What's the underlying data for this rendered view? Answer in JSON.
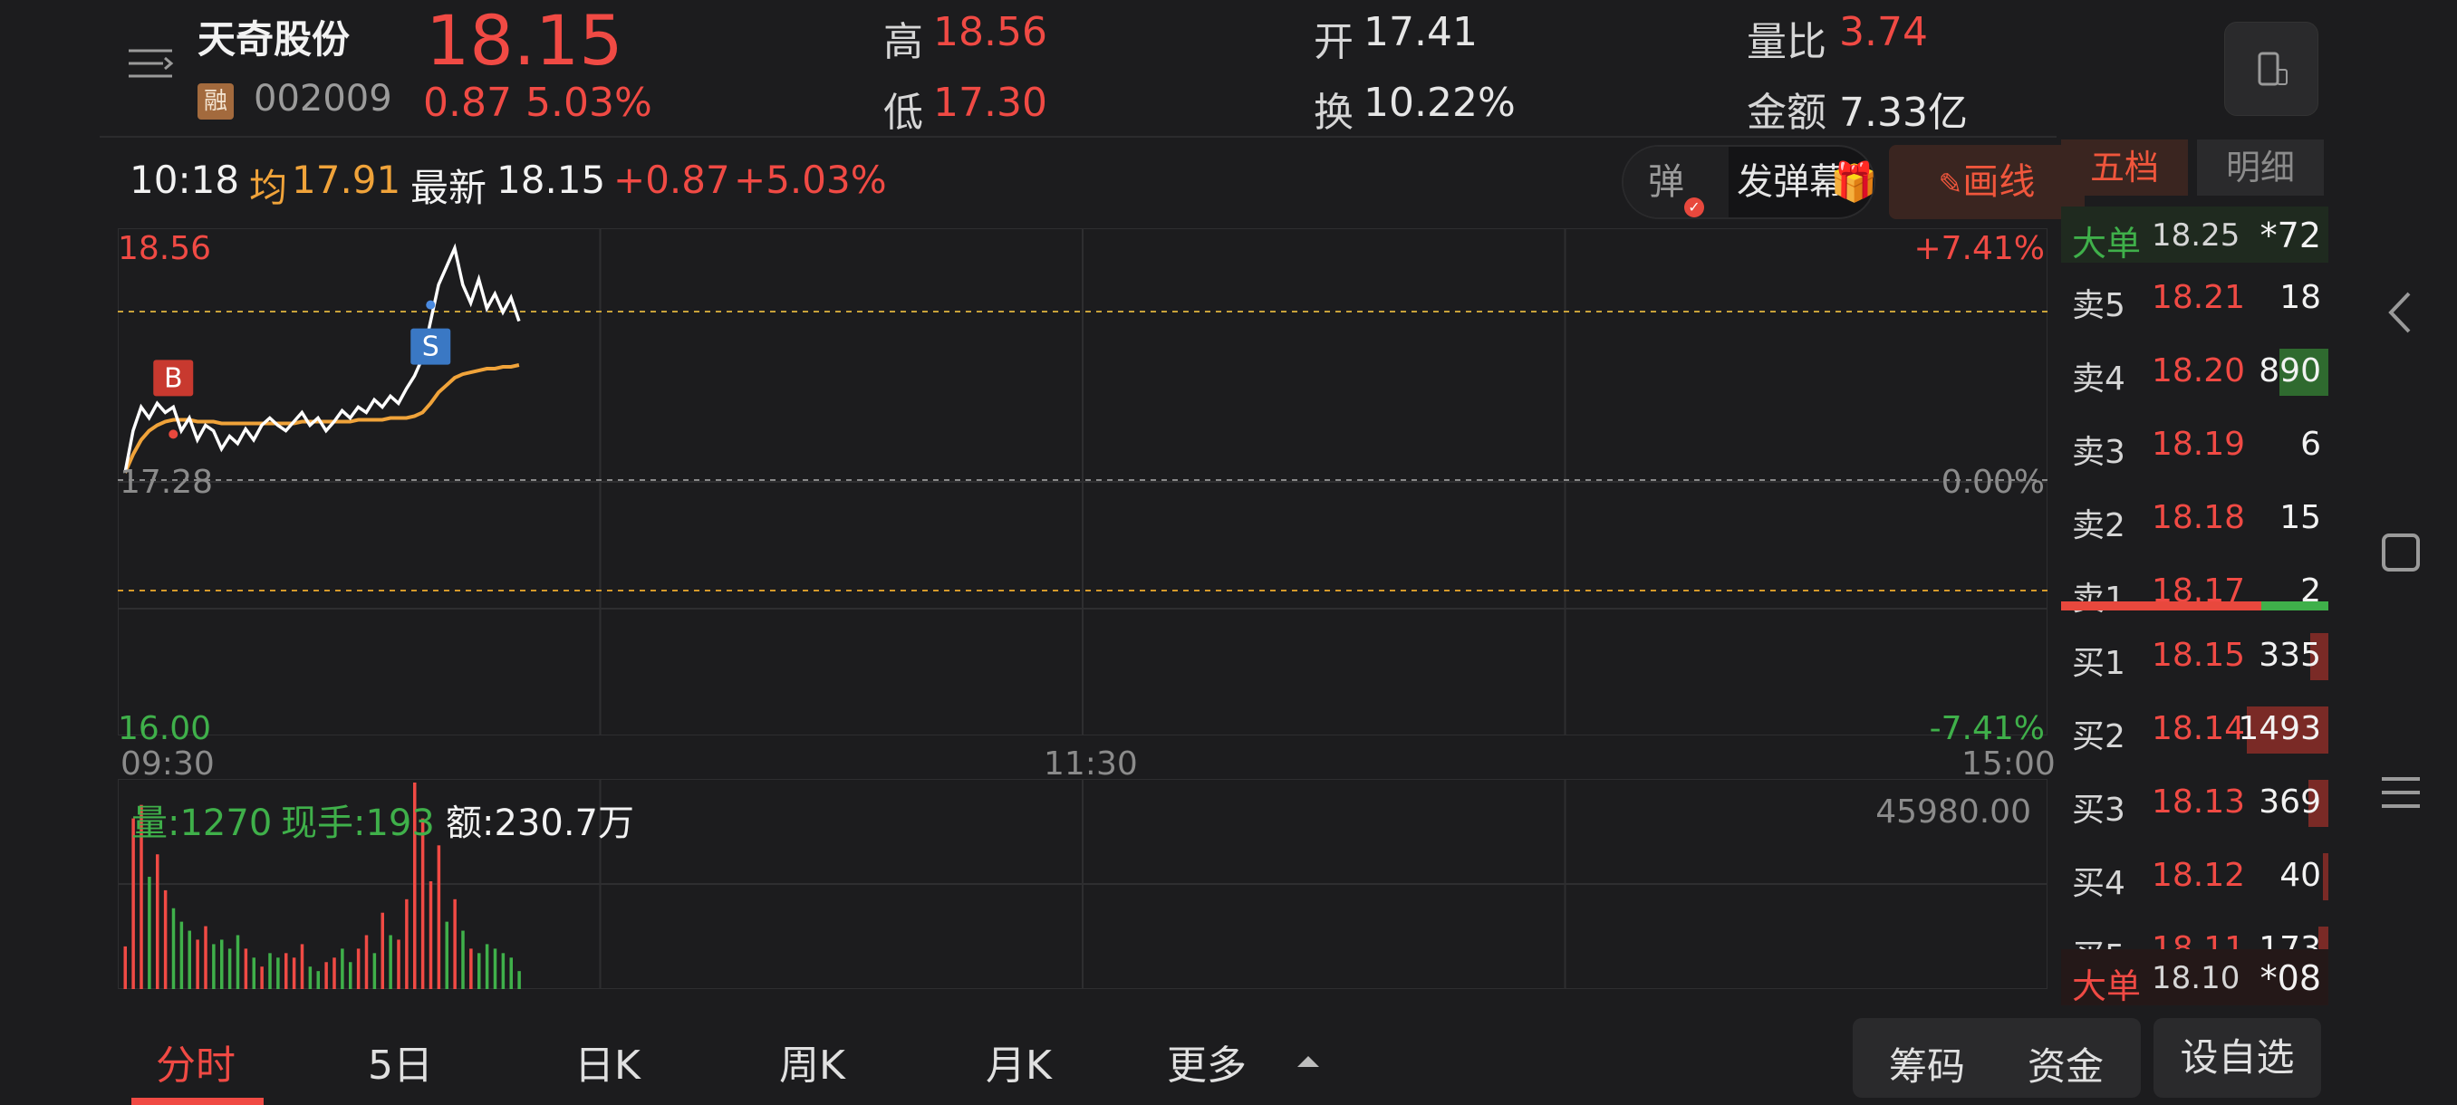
{
  "stock": {
    "name": "天奇股份",
    "badge": "融",
    "code": "002009",
    "price": "18.15",
    "change_abs": "0.87",
    "change_pct": "5.03%"
  },
  "stats": {
    "high_label": "高",
    "high": "18.56",
    "low_label": "低",
    "low": "17.30",
    "open_label": "开",
    "open": "17.41",
    "turnover_label": "换",
    "turnover": "10.22%",
    "vol_ratio_label": "量比",
    "vol_ratio": "3.74",
    "amount_label": "金额",
    "amount": "7.33亿"
  },
  "info": {
    "time": "10:18",
    "avg_label": "均",
    "avg": "17.91",
    "latest_label": "最新",
    "latest": "18.15",
    "change": "+0.87",
    "change_pct": "+5.03%"
  },
  "controls": {
    "danmu_toggle": "弹",
    "send_danmu": "发弹幕",
    "draw_line": "画线"
  },
  "chart_labels": {
    "y_top": "18.56",
    "y_mid": "17.28",
    "y_bottom": "16.00",
    "pct_top": "+7.41%",
    "pct_mid": "0.00%",
    "pct_bottom": "-7.41%",
    "x_start": "09:30",
    "x_mid": "11:30",
    "x_end": "15:00",
    "buy_marker": "B",
    "sell_marker": "S"
  },
  "volume": {
    "vol_label": "量:1270",
    "current_label": "现手:193",
    "amount_label": "额:230.7万",
    "max": "45980.00"
  },
  "chart_data": {
    "type": "line",
    "x_range": [
      "09:30",
      "15:00"
    ],
    "ylim": [
      16.0,
      18.56
    ],
    "series": [
      {
        "name": "最新",
        "values": [
          17.32,
          17.55,
          17.68,
          17.62,
          17.7,
          17.65,
          17.68,
          17.55,
          17.62,
          17.5,
          17.58,
          17.55,
          17.45,
          17.52,
          17.48,
          17.56,
          17.5,
          17.58,
          17.62,
          17.58,
          17.55,
          17.6,
          17.65,
          17.58,
          17.62,
          17.55,
          17.6,
          17.66,
          17.62,
          17.68,
          17.65,
          17.72,
          17.68,
          17.74,
          17.7,
          17.78,
          17.85,
          17.95,
          18.15,
          18.35,
          18.45,
          18.55,
          18.35,
          18.25,
          18.38,
          18.22,
          18.3,
          18.2,
          18.28,
          18.15
        ]
      },
      {
        "name": "均",
        "values": [
          17.32,
          17.42,
          17.5,
          17.55,
          17.58,
          17.6,
          17.61,
          17.61,
          17.61,
          17.6,
          17.6,
          17.6,
          17.59,
          17.59,
          17.59,
          17.59,
          17.59,
          17.59,
          17.59,
          17.59,
          17.59,
          17.59,
          17.6,
          17.6,
          17.6,
          17.6,
          17.6,
          17.6,
          17.6,
          17.61,
          17.61,
          17.61,
          17.61,
          17.62,
          17.62,
          17.62,
          17.63,
          17.65,
          17.7,
          17.76,
          17.8,
          17.84,
          17.86,
          17.87,
          17.88,
          17.89,
          17.89,
          17.9,
          17.9,
          17.91
        ]
      }
    ],
    "volumes": [
      {
        "v": 9500,
        "c": "r"
      },
      {
        "v": 38000,
        "c": "r"
      },
      {
        "v": 41000,
        "c": "r"
      },
      {
        "v": 25000,
        "c": "g"
      },
      {
        "v": 30000,
        "c": "r"
      },
      {
        "v": 22000,
        "c": "r"
      },
      {
        "v": 18000,
        "c": "g"
      },
      {
        "v": 15000,
        "c": "g"
      },
      {
        "v": 13000,
        "c": "g"
      },
      {
        "v": 11000,
        "c": "r"
      },
      {
        "v": 14000,
        "c": "r"
      },
      {
        "v": 10000,
        "c": "g"
      },
      {
        "v": 11000,
        "c": "g"
      },
      {
        "v": 9000,
        "c": "g"
      },
      {
        "v": 12000,
        "c": "g"
      },
      {
        "v": 9000,
        "c": "r"
      },
      {
        "v": 7000,
        "c": "g"
      },
      {
        "v": 5000,
        "c": "r"
      },
      {
        "v": 8000,
        "c": "g"
      },
      {
        "v": 7000,
        "c": "g"
      },
      {
        "v": 8000,
        "c": "r"
      },
      {
        "v": 7000,
        "c": "r"
      },
      {
        "v": 10000,
        "c": "r"
      },
      {
        "v": 5000,
        "c": "g"
      },
      {
        "v": 4000,
        "c": "g"
      },
      {
        "v": 6000,
        "c": "r"
      },
      {
        "v": 7000,
        "c": "r"
      },
      {
        "v": 9000,
        "c": "g"
      },
      {
        "v": 6000,
        "c": "g"
      },
      {
        "v": 9000,
        "c": "r"
      },
      {
        "v": 12000,
        "c": "r"
      },
      {
        "v": 8000,
        "c": "g"
      },
      {
        "v": 17000,
        "c": "r"
      },
      {
        "v": 12000,
        "c": "g"
      },
      {
        "v": 11000,
        "c": "r"
      },
      {
        "v": 20000,
        "c": "r"
      },
      {
        "v": 45980,
        "c": "r"
      },
      {
        "v": 38000,
        "c": "r"
      },
      {
        "v": 24000,
        "c": "r"
      },
      {
        "v": 32000,
        "c": "r"
      },
      {
        "v": 15000,
        "c": "g"
      },
      {
        "v": 20000,
        "c": "r"
      },
      {
        "v": 13000,
        "c": "g"
      },
      {
        "v": 9000,
        "c": "r"
      },
      {
        "v": 8000,
        "c": "g"
      },
      {
        "v": 10000,
        "c": "g"
      },
      {
        "v": 9000,
        "c": "g"
      },
      {
        "v": 8000,
        "c": "g"
      },
      {
        "v": 7000,
        "c": "g"
      },
      {
        "v": 4000,
        "c": "g"
      }
    ]
  },
  "orderbook": {
    "tab_active": "五档",
    "tab_other": "明细",
    "big_top": {
      "label": "大单",
      "price": "18.25",
      "qty": "*72"
    },
    "asks": [
      {
        "label": "卖5",
        "price": "18.21",
        "qty": "18",
        "fill": 0.0
      },
      {
        "label": "卖4",
        "price": "18.20",
        "qty": "890",
        "fill": 0.6
      },
      {
        "label": "卖3",
        "price": "18.19",
        "qty": "6",
        "fill": 0.0
      },
      {
        "label": "卖2",
        "price": "18.18",
        "qty": "15",
        "fill": 0.0
      },
      {
        "label": "卖1",
        "price": "18.17",
        "qty": "2",
        "fill": 0.0
      }
    ],
    "bids": [
      {
        "label": "买1",
        "price": "18.15",
        "qty": "335",
        "fill": 0.22
      },
      {
        "label": "买2",
        "price": "18.14",
        "qty": "1493",
        "fill": 1.0
      },
      {
        "label": "买3",
        "price": "18.13",
        "qty": "369",
        "fill": 0.25
      },
      {
        "label": "买4",
        "price": "18.12",
        "qty": "40",
        "fill": 0.03
      },
      {
        "label": "买5",
        "price": "18.11",
        "qty": "173",
        "fill": 0.12
      }
    ],
    "big_bottom": {
      "label": "大单",
      "price": "18.10",
      "qty": "*08"
    },
    "bid_ask_ratio": 0.75
  },
  "tabs": {
    "items": [
      "分时",
      "5日",
      "日K",
      "周K",
      "月K",
      "更多"
    ],
    "chips": "筹码",
    "funds": "资金",
    "add_watch": "设自选"
  },
  "colors": {
    "up": "#f04a44",
    "down": "#3fb04a",
    "avg_line": "#f0a33a",
    "price_line": "#ffffff",
    "background": "#1c1c1e"
  }
}
